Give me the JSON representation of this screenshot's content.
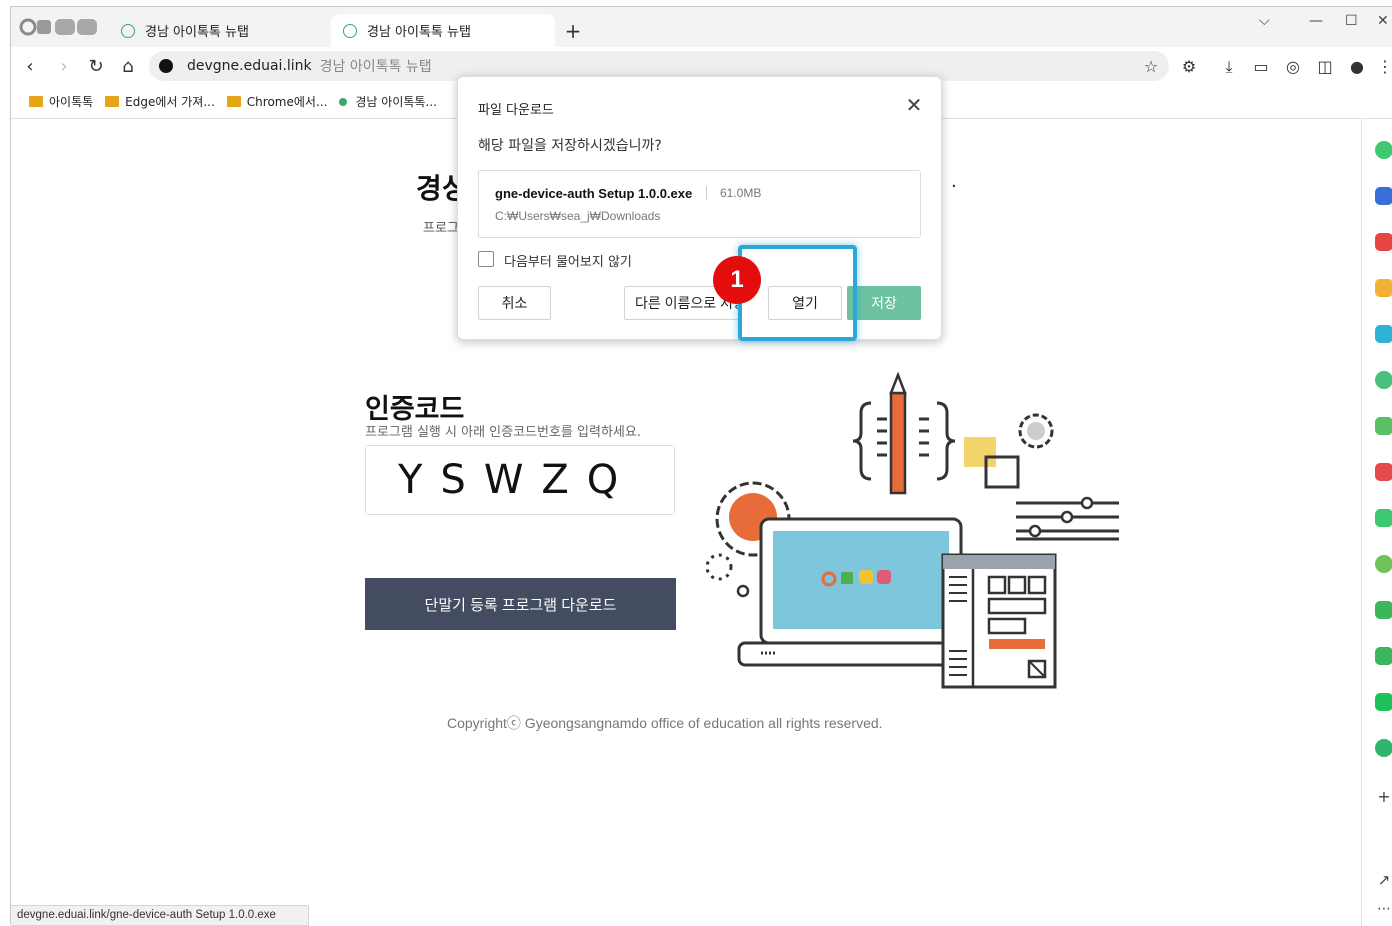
{
  "browser": {
    "tabs": [
      {
        "label": "경남 아이톡톡 뉴탭",
        "active": false
      },
      {
        "label": "경남 아이톡톡 뉴탭",
        "active": true
      }
    ],
    "new_tab": "+",
    "window_controls": [
      "⌵",
      "—",
      "☐",
      "✕"
    ],
    "address": {
      "host": "devgne.eduai.link",
      "title": "경남 아이톡톡 뉴탭"
    },
    "bookmarks": [
      {
        "label": "아이톡톡",
        "icon": "folder-icon"
      },
      {
        "label": "Edge에서 가져...",
        "icon": "folder-icon"
      },
      {
        "label": "Chrome에서...",
        "icon": "folder-icon"
      },
      {
        "label": "경남 아이톡톡...",
        "icon": "site-icon"
      }
    ],
    "status_url": "devgne.eduai.link/gne-device-auth Setup 1.0.0.exe"
  },
  "page": {
    "title_fragment": "경싱",
    "subtitle_fragment": "프로그",
    "trailing_dot": ".",
    "auth_title": "인증코드",
    "auth_desc": "프로그램 실행 시 아래 인증코드번호를 입력하세요.",
    "auth_code": "YSWZQ",
    "download_button": "단말기 등록 프로그램 다운로드",
    "copyright": "Copyrightⓒ Gyeongsangnamdo office of education all rights reserved."
  },
  "dialog": {
    "title": "파일 다운로드",
    "question": "해당 파일을 저장하시겠습니까?",
    "file_name": "gne-device-auth Setup 1.0.0.exe",
    "file_size": "61.0MB",
    "file_path": "C:₩Users₩sea_j₩Downloads",
    "checkbox_label": "다음부터 물어보지 않기",
    "cancel": "취소",
    "save_as": "다른 이름으로 저장",
    "open": "열기",
    "save": "저장"
  },
  "annotation": {
    "step": "1",
    "color": "#e40d0d",
    "highlight_color": "#2da6d8"
  },
  "colors": {
    "accent_save": "#6cc2a1",
    "download_button_bg": "#434c60",
    "brand_green": "#3aa76d"
  }
}
